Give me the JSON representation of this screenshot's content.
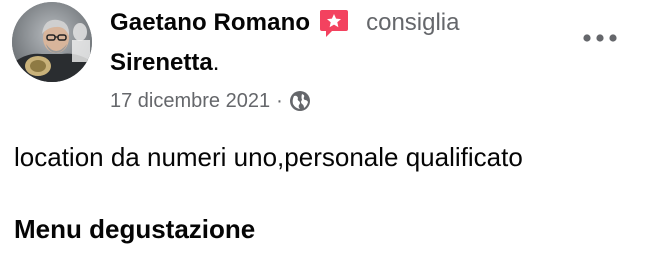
{
  "post": {
    "author": "Gaetano Romano",
    "action": "consiglia",
    "page": "Sirenetta",
    "page_suffix": ".",
    "date": "17 dicembre 2021",
    "separator": "·",
    "privacy_icon": "globe-icon",
    "recommend_icon": "star-speech-bubble-icon",
    "more_icon": "more-horizontal-icon",
    "text": "location da numeri uno,personale qualificato",
    "section_heading": "Menu degustazione"
  },
  "colors": {
    "primary_text": "#050505",
    "secondary_text": "#65676b",
    "recommend_accent": "#f3425f",
    "background": "#ffffff"
  }
}
